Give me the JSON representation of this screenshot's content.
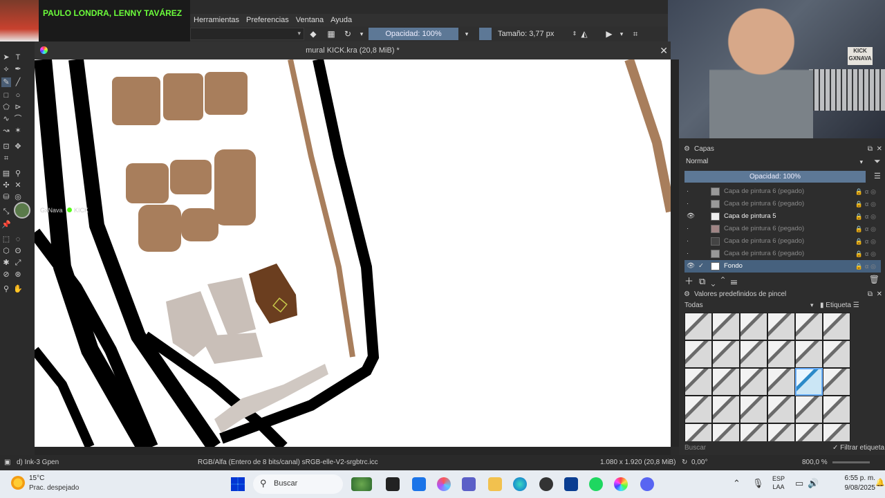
{
  "stream": {
    "song": "PAULO LONDRA, LENNY TAVÁREZ",
    "cam_sign": "KICK GXNAVA",
    "chat_user": "GxNava",
    "chat_platform": "KICK"
  },
  "menubar": {
    "items": [
      "Herramientas",
      "Preferencias",
      "Ventana",
      "Ayuda"
    ]
  },
  "toolbar": {
    "opacity_label": "Opacidad: 100%",
    "size_label": "Tamaño: 3,77 px"
  },
  "document": {
    "title": "mural KICK.kra (20,8 MiB) *",
    "close_glyph": "✕"
  },
  "layers_docker": {
    "title": "Capas",
    "blend_mode": "Normal",
    "opacity_label": "Opacidad:  100%",
    "layers": [
      {
        "name": "Capa de pintura 6 (pegado)",
        "visible": false,
        "state": "dim"
      },
      {
        "name": "Capa de pintura 6 (pegado)",
        "visible": false,
        "state": "dim"
      },
      {
        "name": "Capa de pintura 5",
        "visible": true,
        "state": "active"
      },
      {
        "name": "Capa de pintura 6 (pegado)",
        "visible": false,
        "state": "dim"
      },
      {
        "name": "Capa de pintura 6 (pegado)",
        "visible": false,
        "state": "dim"
      },
      {
        "name": "Capa de pintura 6 (pegado)",
        "visible": false,
        "state": "dim"
      },
      {
        "name": "Fondo",
        "visible": true,
        "state": "selected"
      }
    ]
  },
  "brushes_docker": {
    "title": "Valores predefinidos de pincel",
    "filter": "Todas",
    "tag_label": "Etiqueta",
    "search_placeholder": "Buscar",
    "filter_tag_label": "Filtrar etiqueta",
    "selected_index": 16,
    "count": 30
  },
  "statusbar": {
    "brush": "d) Ink-3 Gpen",
    "color_space": "RGB/Alfa (Entero de 8 bits/canal)  sRGB-elle-V2-srgbtrc.icc",
    "dimensions": "1.080 x 1.920 (20,8 MiB)",
    "rotation": "0,00°",
    "zoom": "800,0 %"
  },
  "taskbar": {
    "temp": "15°C",
    "condition": "Prac. despejado",
    "search_label": "Buscar",
    "lang_line1": "ESP",
    "lang_line2": "LAA",
    "time": "6:55 p. m.",
    "date": "9/08/2025"
  },
  "colors": {
    "accent": "#5d7896",
    "brown_light": "#a87e5c",
    "brown_dark": "#6b3e1f",
    "grey_shape": "#c9bfb8"
  }
}
